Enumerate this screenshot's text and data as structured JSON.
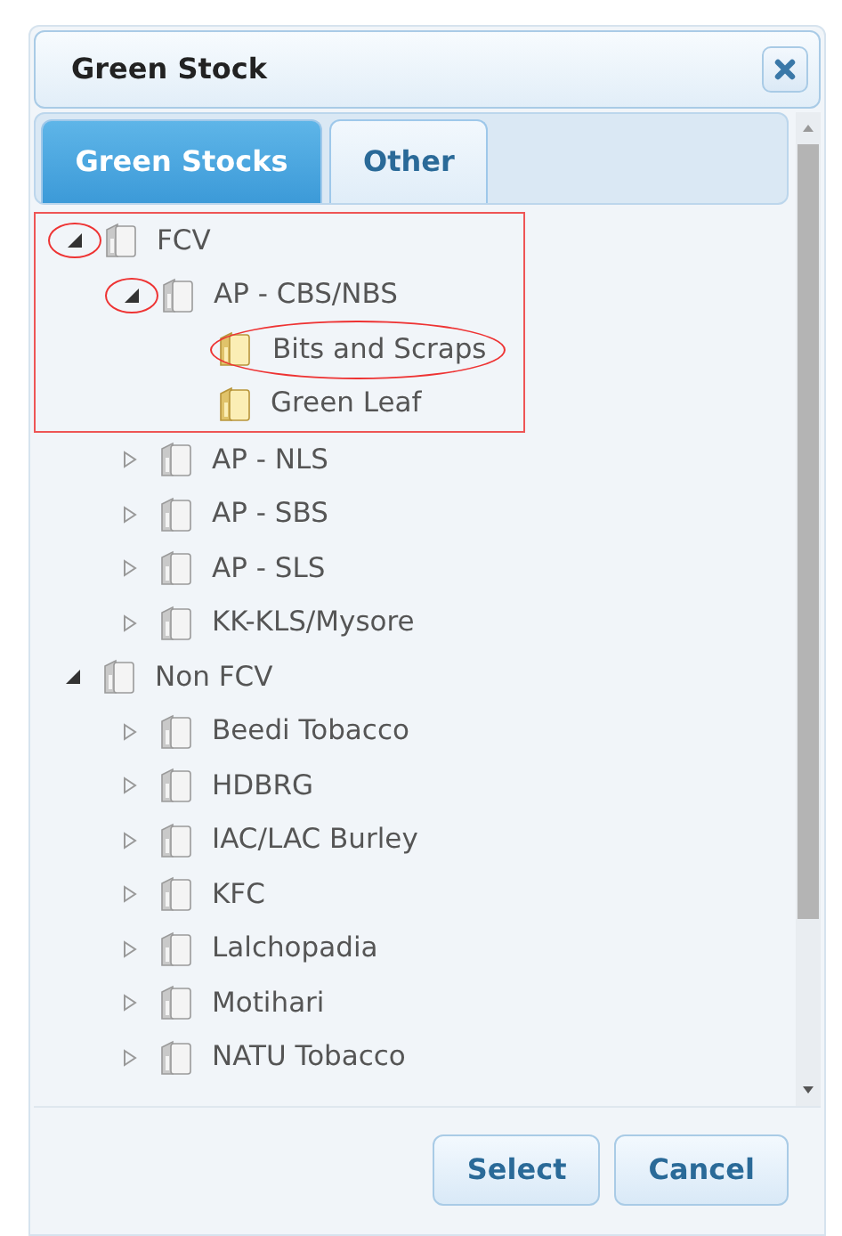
{
  "dialog": {
    "title": "Green Stock"
  },
  "tabs": [
    {
      "label": "Green Stocks",
      "selected": true
    },
    {
      "label": "Other",
      "selected": false
    }
  ],
  "tree": [
    {
      "label": "FCV",
      "kind": "group",
      "expanded": true,
      "boxed": true,
      "toggle_circled": true,
      "children": [
        {
          "label": "AP - CBS/NBS",
          "kind": "group",
          "expanded": true,
          "toggle_circled": true,
          "children": [
            {
              "label": "Bits and Scraps",
              "kind": "leaf",
              "label_circled": true
            },
            {
              "label": "Green Leaf",
              "kind": "leaf"
            }
          ]
        },
        {
          "label": "AP - NLS",
          "kind": "group",
          "expanded": false
        },
        {
          "label": "AP - SBS",
          "kind": "group",
          "expanded": false
        },
        {
          "label": "AP - SLS",
          "kind": "group",
          "expanded": false
        },
        {
          "label": "KK-KLS/Mysore",
          "kind": "group",
          "expanded": false
        }
      ]
    },
    {
      "label": "Non FCV",
      "kind": "group",
      "expanded": true,
      "children": [
        {
          "label": "Beedi Tobacco",
          "kind": "group",
          "expanded": false
        },
        {
          "label": "HDBRG",
          "kind": "group",
          "expanded": false
        },
        {
          "label": "IAC/LAC Burley",
          "kind": "group",
          "expanded": false
        },
        {
          "label": "KFC",
          "kind": "group",
          "expanded": false
        },
        {
          "label": "Lalchopadia",
          "kind": "group",
          "expanded": false
        },
        {
          "label": "Motihari",
          "kind": "group",
          "expanded": false
        },
        {
          "label": "NATU Tobacco",
          "kind": "group",
          "expanded": false
        }
      ]
    }
  ],
  "buttons": [
    "Select",
    "Cancel"
  ]
}
